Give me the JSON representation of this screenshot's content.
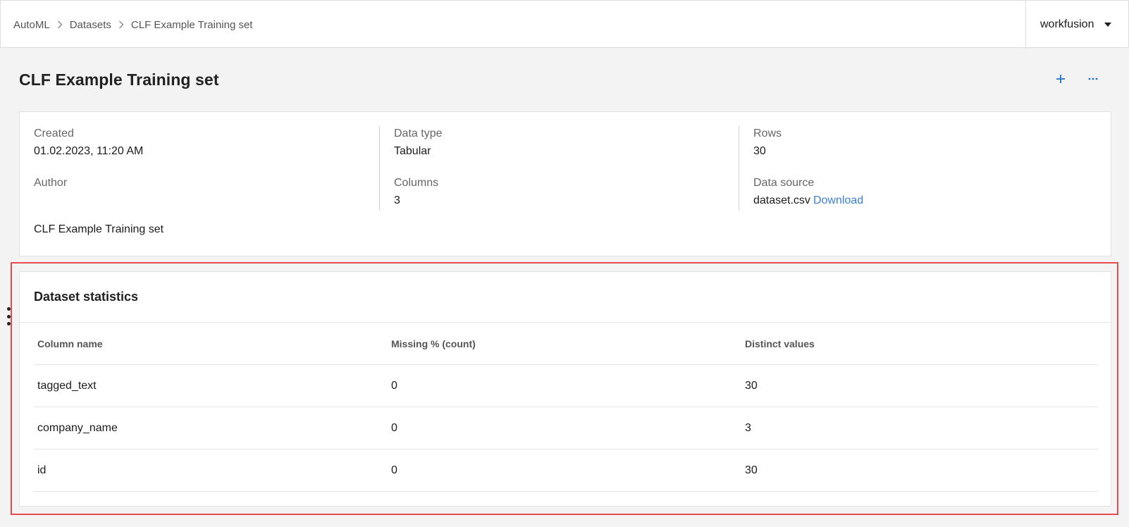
{
  "breadcrumb": {
    "items": [
      "AutoML",
      "Datasets"
    ],
    "current": "CLF Example Training set"
  },
  "user": {
    "name": "workfusion"
  },
  "page": {
    "title": "CLF Example Training set"
  },
  "actions": {
    "add_icon": "plus-icon",
    "more_icon": "ellipsis-icon"
  },
  "info": {
    "created_label": "Created",
    "created_value": "01.02.2023, 11:20 AM",
    "author_label": "Author",
    "author_value": "",
    "data_type_label": "Data type",
    "data_type_value": "Tabular",
    "columns_label": "Columns",
    "columns_value": "3",
    "rows_label": "Rows",
    "rows_value": "30",
    "data_source_label": "Data source",
    "data_source_file": "dataset.csv",
    "download_label": "Download",
    "description": "CLF Example Training set"
  },
  "stats": {
    "title": "Dataset statistics",
    "columns": [
      "Column name",
      "Missing % (count)",
      "Distinct values"
    ],
    "rows": [
      [
        "tagged_text",
        "0",
        "30"
      ],
      [
        "company_name",
        "0",
        "3"
      ],
      [
        "id",
        "0",
        "30"
      ]
    ]
  },
  "colors": {
    "accent": "#1f6fd1",
    "link": "#3b7fd9",
    "highlight": "#e84b4b"
  }
}
